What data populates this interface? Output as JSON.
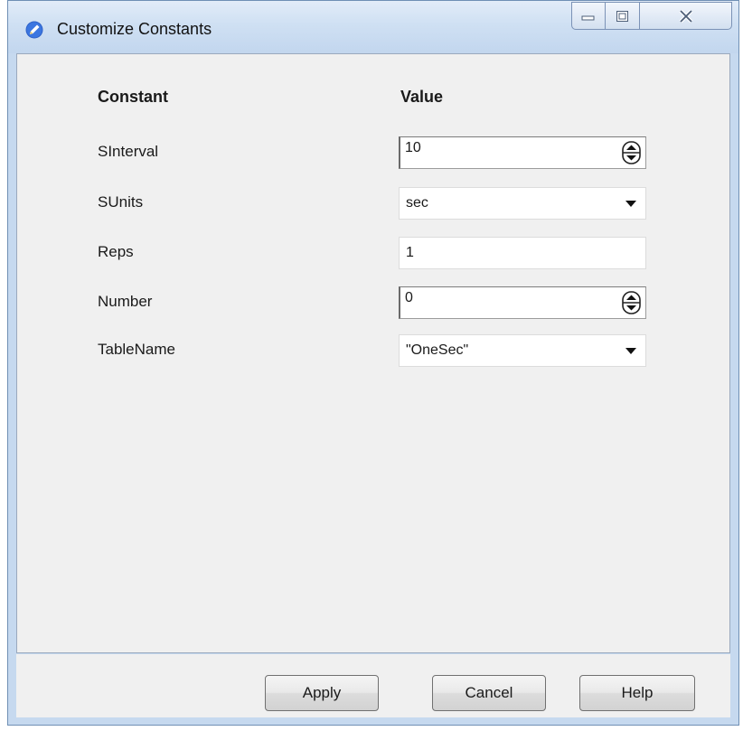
{
  "window": {
    "title": "Customize Constants",
    "controls": {
      "minimize": "minimize",
      "maximize": "maximize",
      "close": "close"
    }
  },
  "table": {
    "header_constant": "Constant",
    "header_value": "Value",
    "rows": [
      {
        "name": "SInterval",
        "value": "10",
        "control": "spinbox"
      },
      {
        "name": "SUnits",
        "value": "sec",
        "control": "dropdown"
      },
      {
        "name": "Reps",
        "value": "1",
        "control": "textbox"
      },
      {
        "name": "Number",
        "value": "0",
        "control": "spinbox"
      },
      {
        "name": "TableName",
        "value": "\"OneSec\"",
        "control": "dropdown"
      }
    ]
  },
  "buttons": {
    "apply": "Apply",
    "cancel": "Cancel",
    "help": "Help"
  },
  "icons": {
    "app": "pencil-icon",
    "spin": "spin-updown-icon",
    "dropdown": "chevron-down-icon"
  },
  "colors": {
    "titlebar": "#cfe0f3",
    "frame": "#c6d9ef",
    "content_bg": "#f0f0f0"
  }
}
